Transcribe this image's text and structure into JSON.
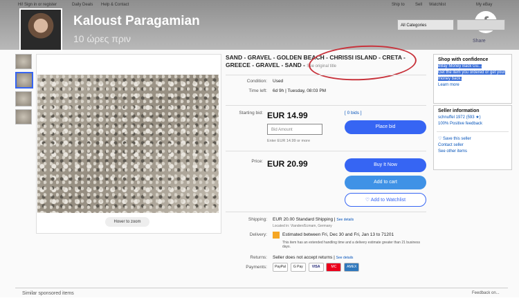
{
  "top_nav": {
    "sign_in": "Hi! Sign in or register",
    "daily_deals": "Daily Deals",
    "help": "Help & Contact",
    "ship_to": "Ship to",
    "sell": "Sell",
    "watchlist": "Watchlist",
    "my_ebay": "My eBay"
  },
  "fb": {
    "name": "Kaloust Paragamian",
    "time": "10 ώρες πριν",
    "icon": "f"
  },
  "search": {
    "category": "All Categories"
  },
  "share_label": "Share",
  "listing": {
    "title": "SAND - GRAVEL - GOLDEN BEACH - CHRISSI ISLAND - CRETA - GREECE - GRAVEL - SAND -",
    "see_original": "See original title",
    "condition_label": "Condition:",
    "condition": "Used",
    "time_left_label": "Time left:",
    "time_left": "6d 9h | Tuesday, 08:03 PM",
    "starting_bid_label": "Starting bid:",
    "starting_bid": "EUR 14.99",
    "bids": "[ 0 bids ]",
    "bid_placeholder": "Bid Amount",
    "bid_hint": "Enter EUR 14.99 or more",
    "place_bid": "Place bid",
    "price_label": "Price:",
    "price": "EUR 20.99",
    "buy_now": "Buy It Now",
    "add_cart": "Add to cart",
    "add_watch": "♡ Add to Watchlist",
    "hover_zoom": "Hover to zoom",
    "shipping_label": "Shipping:",
    "shipping": "EUR 20.00 Standard Shipping |",
    "see_details": "See details",
    "located": "Located in: Vianden/Ecmam, Germany",
    "delivery_label": "Delivery:",
    "delivery": "Estimated between Fri, Dec 30 and Fri, Jan 13 to 71201",
    "delivery_note": "This item has an extended handling time and a delivery estimate greater than 21 business days.",
    "returns_label": "Returns:",
    "returns": "Seller does not accept returns |",
    "payments_label": "Payments:",
    "payments": [
      "PayPal",
      "G Pay",
      "VISA",
      "MC",
      "AMEX"
    ]
  },
  "sidebar": {
    "confidence_h": "Shop with confidence",
    "guarantee": "eBay Money Back Gu...",
    "guarantee_desc": "Get the item you ordered or get your money back.",
    "learn_more": "Learn more",
    "seller_h": "Seller information",
    "seller": "schnuffel 1972 (593 ★)",
    "feedback": "100% Positive feedback",
    "save_seller": "♡ Save this seller",
    "contact": "Contact seller",
    "other_items": "See other items"
  },
  "bottom": {
    "similar": "Similar sponsored items",
    "feedback": "Feedback on..."
  }
}
